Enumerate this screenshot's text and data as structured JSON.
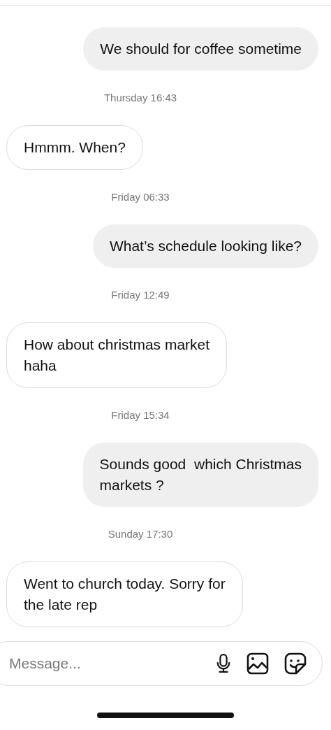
{
  "messages": [
    {
      "kind": "sent",
      "text": "We should for coffee sometime"
    },
    {
      "kind": "timestamp",
      "text": "Thursday 16:43"
    },
    {
      "kind": "received",
      "text": "Hmmm. When?"
    },
    {
      "kind": "timestamp",
      "text": "Friday 06:33"
    },
    {
      "kind": "sent",
      "text": "What’s schedule looking like?"
    },
    {
      "kind": "timestamp",
      "text": "Friday 12:49"
    },
    {
      "kind": "received",
      "text": "How about christmas market\nhaha"
    },
    {
      "kind": "timestamp",
      "text": "Friday 15:34"
    },
    {
      "kind": "sent",
      "text": "Sounds good  which Christmas\nmarkets ?"
    },
    {
      "kind": "timestamp",
      "text": "Sunday 17:30"
    },
    {
      "kind": "received",
      "text": "Went to church today. Sorry for\nthe late rep"
    }
  ],
  "composer": {
    "placeholder": "Message..."
  }
}
